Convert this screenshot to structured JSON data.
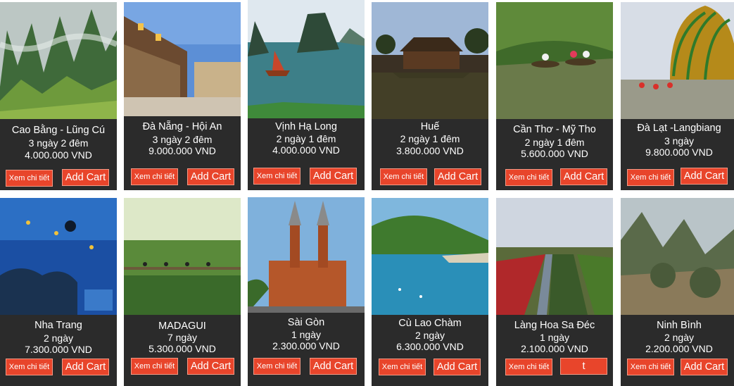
{
  "tours": [
    {
      "name": "Cao Bằng - Lũng Cú",
      "duration": "3 ngày 2 đêm",
      "price": "4.000.000 VND",
      "detail_label": "Xem chi tiết",
      "cart_label": "Add Cart"
    },
    {
      "name": "Đà Nẵng - Hội An",
      "duration": "3 ngày 2 đêm",
      "price": "9.000.000 VND",
      "detail_label": "Xem chi tiết",
      "cart_label": "Add Cart"
    },
    {
      "name": "Vịnh Hạ Long",
      "duration": "2 ngày 1 đêm",
      "price": "4.000.000 VND",
      "detail_label": "Xem chi tiết",
      "cart_label": "Add Cart"
    },
    {
      "name": "Huế",
      "duration": "2 ngày 1 đêm",
      "price": "3.800.000 VND",
      "detail_label": "Xem chi tiết",
      "cart_label": "Add Cart"
    },
    {
      "name": "Cần Thơ - Mỹ Tho",
      "duration": "2 ngày 1 đêm",
      "price": "5.600.000 VND",
      "detail_label": "Xem chi tiết",
      "cart_label": "Add Cart"
    },
    {
      "name": "Đà Lạt -Langbiang",
      "duration": "3 ngày",
      "price": "9.800.000 VND",
      "detail_label": "Xem chi tiết",
      "cart_label": "Add Cart"
    },
    {
      "name": "Nha Trang",
      "duration": "2 ngày",
      "price": "7.300.000 VND",
      "detail_label": "Xem chi tiết",
      "cart_label": "Add Cart"
    },
    {
      "name": "MADAGUI",
      "duration": "7 ngày",
      "price": "5.300.000 VND",
      "detail_label": "Xem chi tiết",
      "cart_label": "Add Cart"
    },
    {
      "name": "Sài Gòn",
      "duration": "1 ngày",
      "price": "2.300.000 VND",
      "detail_label": "Xem chi tiết",
      "cart_label": "Add Cart"
    },
    {
      "name": "Cù Lao Chàm",
      "duration": "2 ngày",
      "price": "6.300.000 VND",
      "detail_label": "Xem chi tiết",
      "cart_label": "Add Cart"
    },
    {
      "name": "Làng Hoa Sa Đéc",
      "duration": "1 ngày",
      "price": "2.100.000 VND",
      "detail_label": "Xem chi tiết",
      "cart_label": "t"
    },
    {
      "name": "Ninh Bình",
      "duration": "2 ngày",
      "price": "2.200.000 VND",
      "detail_label": "Xem chi tiết",
      "cart_label": "Add Cart"
    }
  ],
  "colors": {
    "card_bg": "#2b2b2b",
    "button_bg": "#e8452b",
    "button_text": "#ffffff"
  }
}
